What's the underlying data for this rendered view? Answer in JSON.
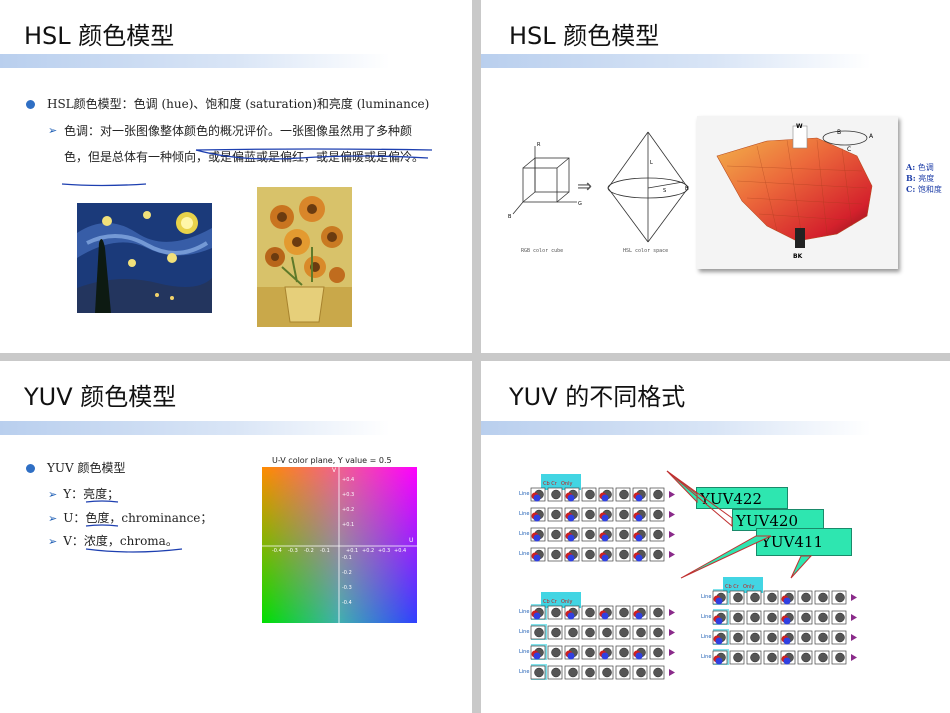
{
  "slide1": {
    "title": "HSL 颜色模型",
    "bullet": "HSL颜色模型：色调 (hue)、饱和度 (saturation)和亮度 (luminance)",
    "sub_prefix": "色调：",
    "sub_text": "对一张图像整体颜色的概况评价。一张图像虽然用了多种颜色，但是总体有一种倾向，或是偏蓝或是偏红，或是偏暖或是偏冷。",
    "images": [
      "starry-night",
      "sunflowers"
    ]
  },
  "slide2": {
    "title": "HSL 颜色模型",
    "rgb_label": "RGB color cube",
    "hsl_label": "HSL color space",
    "axis_labels": [
      "R",
      "G",
      "B",
      "L",
      "S",
      "H"
    ],
    "model_labels": [
      "W",
      "BK",
      "A",
      "B",
      "C"
    ],
    "legend": [
      {
        "key": "A:",
        "text": "色调"
      },
      {
        "key": "B:",
        "text": "亮度"
      },
      {
        "key": "C:",
        "text": "饱和度"
      }
    ]
  },
  "slide3": {
    "title": "YUV 颜色模型",
    "bullet": "YUV 颜色模型",
    "items": [
      {
        "key": "Y：",
        "text": "亮度；"
      },
      {
        "key": "U：",
        "text": "色度，chrominance；"
      },
      {
        "key": "V：",
        "text": "浓度，chroma。"
      }
    ],
    "chart": {
      "title": "U-V color plane, Y value = 0.5",
      "u_axis": "U",
      "v_axis": "V",
      "u_ticks": [
        "-0.4",
        "-0.3",
        "-0.2",
        "-0.1",
        "+0.1",
        "+0.2",
        "+0.3",
        "+0.4"
      ],
      "v_ticks": [
        "+0.4",
        "+0.3",
        "+0.2",
        "+0.1",
        "-0.1",
        "-0.2",
        "-0.3",
        "-0.4"
      ]
    }
  },
  "slide4": {
    "title": "YUV 的不同格式",
    "callouts": [
      "YUV422",
      "YUV420",
      "YUV411"
    ],
    "line_labels": [
      "Line 1",
      "Line 2",
      "Line 3",
      "Line 4"
    ],
    "header_labels": [
      "Cb Cr",
      "Y",
      "Only"
    ],
    "colors": {
      "callout": "#2ee6b0",
      "accent": "#1f5fb5",
      "arrow": "#8a2b8a",
      "header": "#2ed0e0"
    }
  }
}
